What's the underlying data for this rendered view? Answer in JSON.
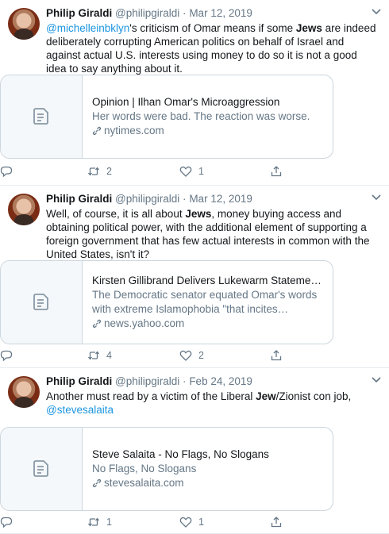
{
  "tweets": [
    {
      "name": "Philip Giraldi",
      "handle": "@philipgiraldi",
      "sep": "·",
      "date": "Mar 12, 2019",
      "text": [
        {
          "t": "@michelleinbklyn",
          "style": "mention"
        },
        {
          "t": "'s criticism of Omar means if some "
        },
        {
          "t": "Jews",
          "style": "bold"
        },
        {
          "t": " are indeed deliberately corrupting American politics on behalf of Israel and against actual U.S. interests using money to do so it is not a good idea to say anything about it."
        }
      ],
      "card": {
        "title": "Opinion | Ilhan Omar's Microaggression",
        "desc": "Her words were bad. The reaction was worse.",
        "domain": "nytimes.com"
      },
      "replies": "",
      "retweets": "2",
      "likes": "1"
    },
    {
      "name": "Philip Giraldi",
      "handle": "@philipgiraldi",
      "sep": "·",
      "date": "Mar 12, 2019",
      "text": [
        {
          "t": "Well, of course, it is all about "
        },
        {
          "t": "Jews",
          "style": "bold"
        },
        {
          "t": ", money buying access and obtaining political power, with the additional element of supporting a foreign government that has few actual interests in common with the United States, isn't it?"
        }
      ],
      "card": {
        "title": "Kirsten Gillibrand Delivers Lukewarm Statement On Il…",
        "desc": "The Democratic senator equated Omar's words with extreme Islamophobia \"that incites violence\" a day …",
        "domain": "news.yahoo.com"
      },
      "replies": "",
      "retweets": "4",
      "likes": "2"
    },
    {
      "name": "Philip Giraldi",
      "handle": "@philipgiraldi",
      "sep": "·",
      "date": "Feb 24, 2019",
      "text": [
        {
          "t": "Another must read by a victim of the Liberal "
        },
        {
          "t": "Jew",
          "style": "bold"
        },
        {
          "t": "/Zionist con job, "
        },
        {
          "t": "@stevesalaita",
          "style": "mention"
        }
      ],
      "card": {
        "title": "Steve Salaita - No Flags, No Slogans",
        "desc": "No Flags, No Slogans",
        "domain": "stevesalaita.com"
      },
      "replies": "",
      "retweets": "1",
      "likes": "1"
    }
  ],
  "icons": {
    "reply": "reply-icon",
    "retweet": "retweet-icon",
    "like": "heart-icon",
    "share": "share-icon",
    "caret": "chevron-down-icon",
    "link": "link-icon",
    "document": "document-icon"
  },
  "colors": {
    "mention": "#1b95e0",
    "secondary": "#657786",
    "border": "#e6ecf0",
    "card_border": "#ccd6dd"
  }
}
